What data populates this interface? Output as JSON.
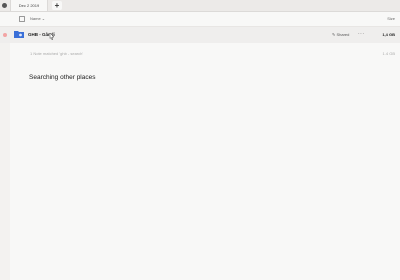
{
  "tabs": [
    {
      "label": "Dec 2 2019"
    }
  ],
  "columns": {
    "name": "Name",
    "size": "Size"
  },
  "rows": [
    {
      "name": "GHB - Gândi",
      "status": "Shared",
      "size": "1,4 GB",
      "icon": "shared-folder-icon",
      "dot_color": "#f2a4a4"
    }
  ],
  "hidden_row": {
    "text": "1 Note matched 'ghb - search'",
    "size": "1.4 GB"
  },
  "searching_text": "Searching other places"
}
